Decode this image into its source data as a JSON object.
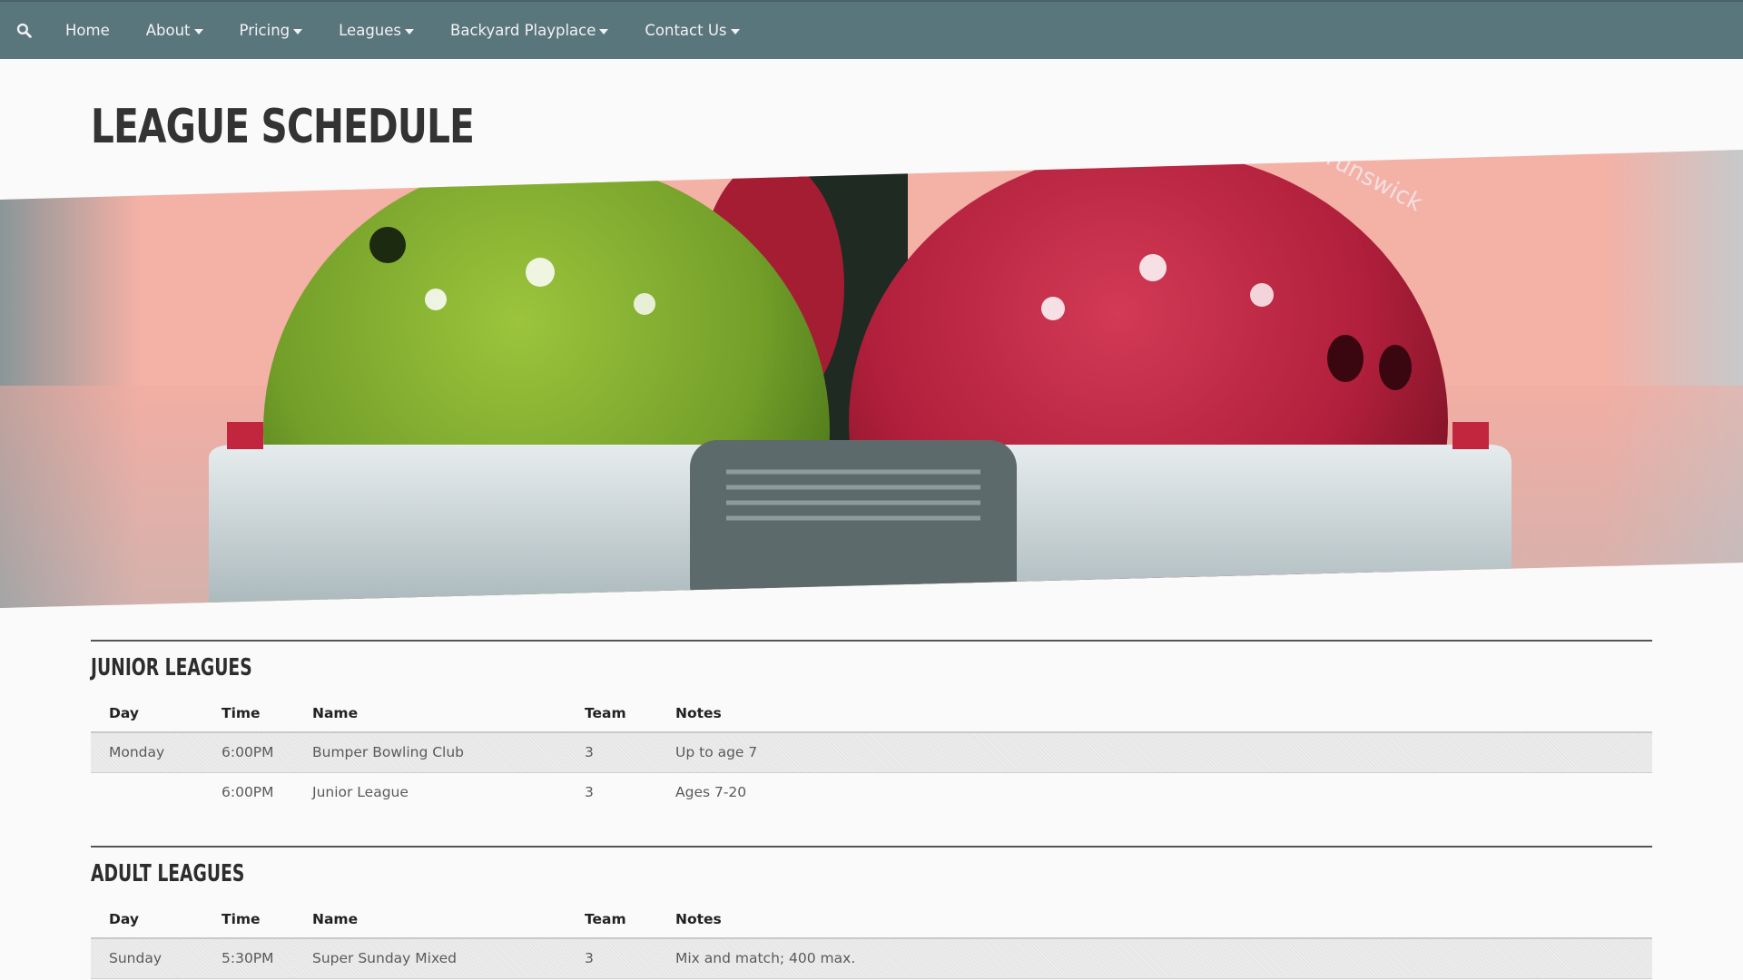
{
  "nav": {
    "search_icon": "search-icon",
    "items": [
      {
        "label": "Home",
        "dropdown": false
      },
      {
        "label": "About",
        "dropdown": true
      },
      {
        "label": "Pricing",
        "dropdown": true
      },
      {
        "label": "Leagues",
        "dropdown": true
      },
      {
        "label": "Backyard Playplace",
        "dropdown": true
      },
      {
        "label": "Contact Us",
        "dropdown": true
      }
    ]
  },
  "page": {
    "title": "LEAGUE SCHEDULE"
  },
  "hero": {
    "brand_text": "Brunswick",
    "colors": {
      "green_ball": "#7da52a",
      "red_ball": "#b8203c",
      "background": "#f4b1a6",
      "return": "#c9d2d4"
    }
  },
  "columns": [
    "Day",
    "Time",
    "Name",
    "Team",
    "Notes"
  ],
  "junior": {
    "title": "JUNIOR LEAGUES",
    "rows": [
      {
        "day": "Monday",
        "time": "6:00PM",
        "name": "Bumper Bowling Club",
        "team": "3",
        "notes": "Up to age 7"
      },
      {
        "day": "",
        "time": "6:00PM",
        "name": "Junior League",
        "team": "3",
        "notes": "Ages 7-20"
      }
    ]
  },
  "adult": {
    "title": "ADULT LEAGUES",
    "rows": [
      {
        "day": "Sunday",
        "time": "5:30PM",
        "name": "Super Sunday Mixed",
        "team": "3",
        "notes": "Mix and match; 400 max."
      }
    ]
  },
  "colors": {
    "navbar": "#5a767d",
    "page_bg": "#fafafa",
    "stripe": "#e6e6e6"
  }
}
